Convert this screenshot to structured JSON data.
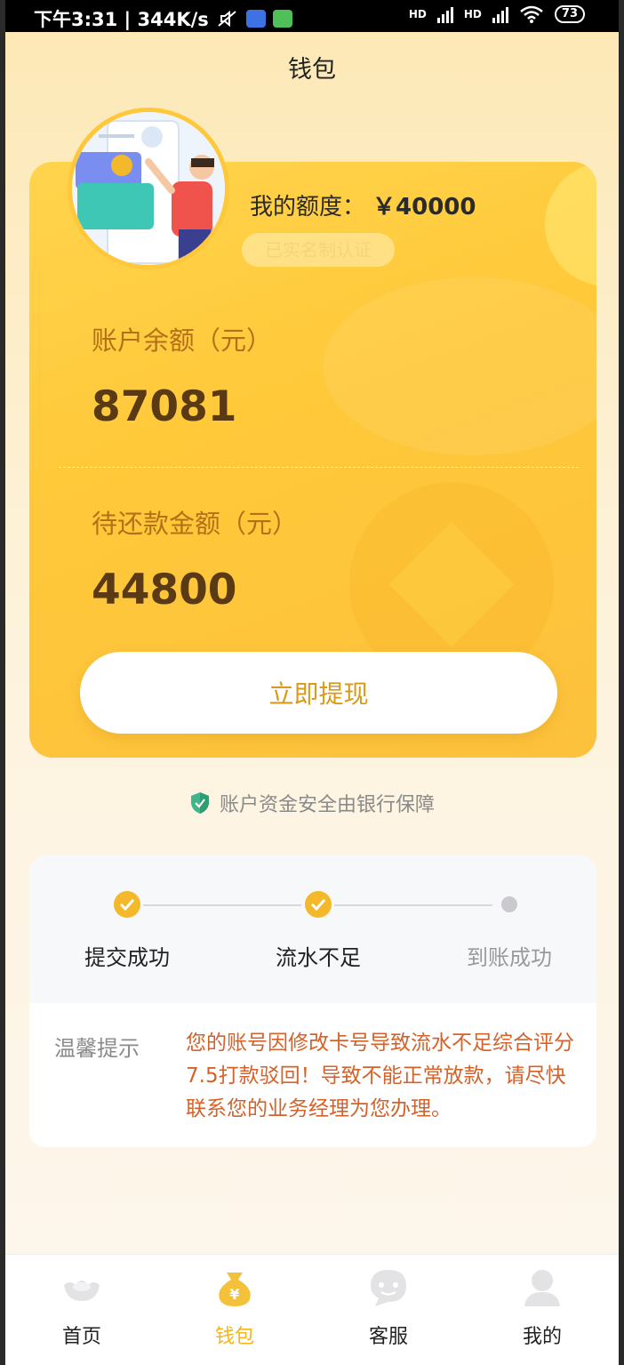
{
  "status_bar": {
    "time_speed": "下午3:31 | 344K/s",
    "battery": "73",
    "hd1": "HD",
    "hd2": "HD"
  },
  "header": {
    "title": "钱包"
  },
  "wallet_card": {
    "quota_label": "我的额度：",
    "quota_value": "￥40000",
    "verified_badge": "已实名制认证",
    "balance_label": "账户余额（元）",
    "balance_value": "87081",
    "repay_label": "待还款金额（元）",
    "repay_value": "44800",
    "withdraw_button": "立即提现"
  },
  "safety_note": "账户资金安全由银行保障",
  "progress": {
    "steps": [
      {
        "label": "提交成功",
        "done": true
      },
      {
        "label": "流水不足",
        "done": true
      },
      {
        "label": "到账成功",
        "done": false
      }
    ],
    "tip_title": "温馨提示",
    "tip_body": "您的账号因修改卡号导致流水不足综合评分7.5打款驳回！导致不能正常放款，请尽快联系您的业务经理为您办理。"
  },
  "tabbar": {
    "items": [
      {
        "label": "首页",
        "icon": "ingot-icon"
      },
      {
        "label": "钱包",
        "icon": "wallet-bag-icon"
      },
      {
        "label": "客服",
        "icon": "chat-bubble-icon"
      },
      {
        "label": "我的",
        "icon": "user-icon"
      }
    ],
    "active_index": 1
  },
  "colors": {
    "accent": "#f1b51f",
    "card": "#ffc93a",
    "warning_text": "#d4622a"
  }
}
